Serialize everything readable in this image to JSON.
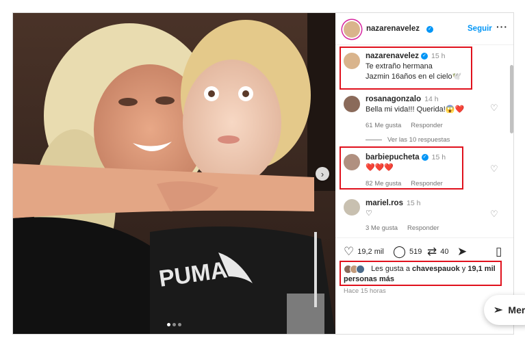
{
  "post": {
    "author": "nazarenavelez",
    "follow_label": "Seguir",
    "more_icon": "more-horizontal-icon",
    "caption": {
      "author": "nazarenavelez",
      "time": "15 h",
      "line1": "Te extraño hermana",
      "line2": "Jazmin 16años en el cielo🕊️"
    },
    "comments": [
      {
        "user": "rosanagonzalo",
        "time": "14 h",
        "text": "Bella mi vida!!! Querida!😱❤️",
        "likes": "61 Me gusta",
        "reply": "Responder"
      },
      {
        "user": "barbiepucheta",
        "time": "15 h",
        "text": "❤️❤️❤️",
        "likes": "82 Me gusta",
        "reply": "Responder"
      },
      {
        "user": "mariel.ros",
        "time": "15 h",
        "text": "♡",
        "likes": "3 Me gusta",
        "reply": "Responder"
      }
    ],
    "view_replies": "Ver las 10 respuestas",
    "actions": {
      "likes_count": "19,2 mil",
      "comments_count": "519",
      "reposts_count": "40"
    },
    "liked_by": {
      "prefix": "Les gusta a",
      "user": "chavespauok",
      "connector": "y",
      "others": "19,1 mil",
      "suffix": "personas más"
    },
    "posted_ago": "Hace 15 horas",
    "messages_label": "Mer"
  },
  "colors": {
    "accent_blue": "#0095f6",
    "highlight_red": "#e0101c",
    "heart_red": "#ed4956"
  }
}
